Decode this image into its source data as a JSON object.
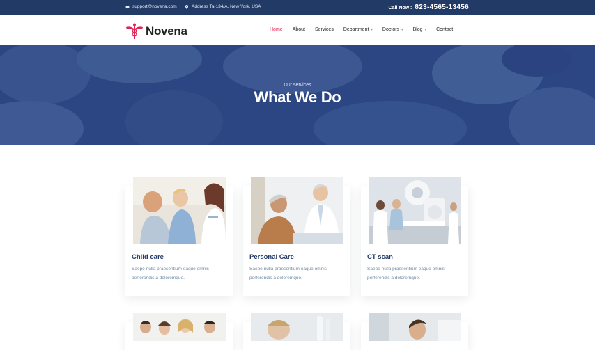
{
  "topbar": {
    "email": "support@novena.com",
    "address": "Address Ta-134/A, New York, USA",
    "call_label": "Call Now :",
    "call_number": "823-4565-13456"
  },
  "brand": {
    "name": "Novena",
    "accent": "#e12454",
    "navy": "#223a66"
  },
  "nav": {
    "items": [
      {
        "label": "Home",
        "active": true
      },
      {
        "label": "About"
      },
      {
        "label": "Services"
      },
      {
        "label": "Department",
        "dropdown": true
      },
      {
        "label": "Doctors",
        "dropdown": true
      },
      {
        "label": "Blog",
        "dropdown": true
      },
      {
        "label": "Contact"
      }
    ]
  },
  "hero": {
    "subtitle": "Our services",
    "title": "What We Do"
  },
  "services": [
    {
      "title": "Child care",
      "text": "Saepe nulla praesentium eaque omnis perferendis a doloremque.",
      "image": "child-care-photo"
    },
    {
      "title": "Personal Care",
      "text": "Saepe nulla praesentium eaque omnis perferendis a doloremque.",
      "image": "personal-care-photo"
    },
    {
      "title": "CT scan",
      "text": "Saepe nulla praesentium eaque omnis perferendis a doloremque.",
      "image": "ct-scan-photo"
    }
  ]
}
